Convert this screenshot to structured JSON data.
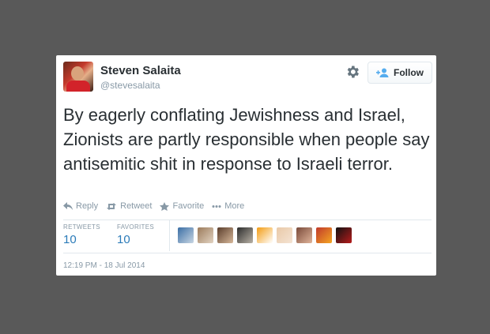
{
  "tweet": {
    "author_name": "Steven Salaita",
    "author_handle": "@stevesalaita",
    "text": "By eagerly conflating Jewishness and Israel, Zionists are partly responsible when people say antisemitic shit in response to Israeli terror.",
    "timestamp": "12:19 PM - 18 Jul 2014"
  },
  "header": {
    "follow_label": "Follow",
    "settings_icon": "gear-icon"
  },
  "actions": [
    {
      "label": "Reply",
      "icon": "reply-icon"
    },
    {
      "label": "Retweet",
      "icon": "retweet-icon"
    },
    {
      "label": "Favorite",
      "icon": "star-icon"
    },
    {
      "label": "More",
      "icon": "more-icon"
    }
  ],
  "stats": {
    "retweets_label": "RETWEETS",
    "retweets_count": "10",
    "favorites_label": "FAVORITES",
    "favorites_count": "10"
  },
  "favoriters": [
    {
      "colors": [
        "#3a6ea5",
        "#c9d6e3"
      ]
    },
    {
      "colors": [
        "#9c7b5b",
        "#e2d3c2"
      ]
    },
    {
      "colors": [
        "#5a3d2b",
        "#d7b89a"
      ]
    },
    {
      "colors": [
        "#2c2c2c",
        "#b9b2a6"
      ]
    },
    {
      "colors": [
        "#f39c12",
        "#ffffff"
      ]
    },
    {
      "colors": [
        "#e9c9a8",
        "#f4e3d3"
      ]
    },
    {
      "colors": [
        "#7a4a3a",
        "#e0b49a"
      ]
    },
    {
      "colors": [
        "#c0392b",
        "#f5a623"
      ]
    },
    {
      "colors": [
        "#111111",
        "#b71c1c"
      ]
    }
  ],
  "colors": {
    "background": "#595959",
    "link": "#2b7bb9",
    "muted": "#8899a6"
  }
}
